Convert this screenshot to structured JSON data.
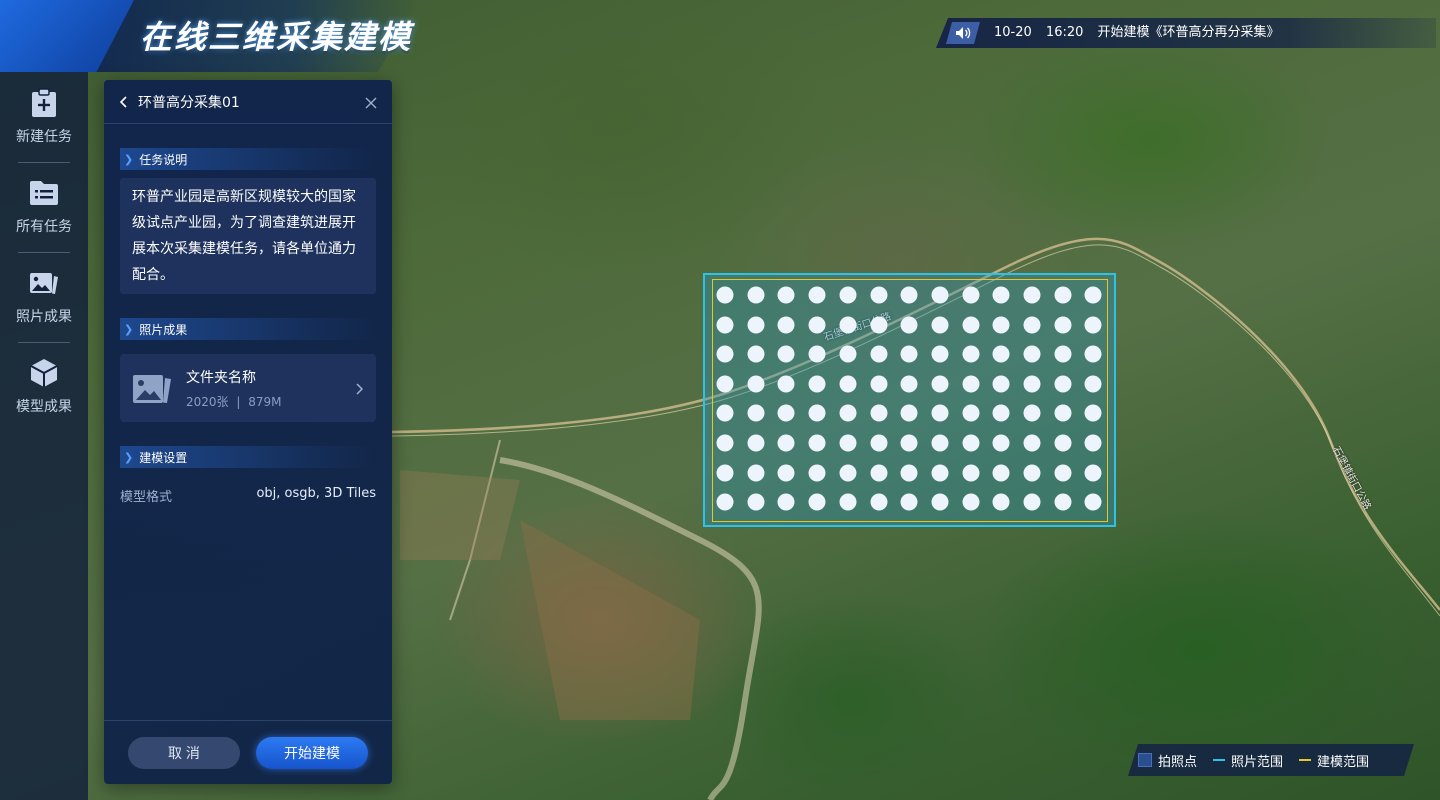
{
  "app": {
    "title": "在线三维采集建模"
  },
  "sidebar": {
    "items": [
      {
        "label": "新建任务",
        "icon": "add-task-icon"
      },
      {
        "label": "所有任务",
        "icon": "task-list-icon"
      },
      {
        "label": "照片成果",
        "icon": "photo-icon"
      },
      {
        "label": "模型成果",
        "icon": "cube-icon"
      }
    ]
  },
  "notice": {
    "icon": "speaker-icon",
    "date": "10-20",
    "time": "16:20",
    "message": "开始建模《环普高分再分采集》"
  },
  "panel": {
    "title": "环普高分采集01",
    "sections": {
      "task_desc_title": "任务说明",
      "task_desc": "环普产业园是高新区规模较大的国家级试点产业园，为了调查建筑进展开展本次采集建模任务，请各单位通力配合。",
      "photos_title": "照片成果",
      "folder_name": "文件夹名称",
      "folder_count": "2020张",
      "folder_sep": "|",
      "folder_size": "879M",
      "modeling_title": "建模设置",
      "model_format_label": "模型格式",
      "model_format_value": "obj, osgb, 3D Tiles"
    },
    "cancel_label": "取 消",
    "start_label": "开始建模"
  },
  "map": {
    "grid_rows": 8,
    "grid_cols": 13,
    "labels": {
      "road1": "石堡镇街口公路",
      "road2": "石堡镇街口公路"
    }
  },
  "legend": {
    "point_label": "拍照点",
    "photo_range_label": "照片范围",
    "model_range_label": "建模范围",
    "colors": {
      "point": "#2a4f8f",
      "photo_range": "#2ec2e8",
      "model_range": "#e8c62a"
    }
  }
}
